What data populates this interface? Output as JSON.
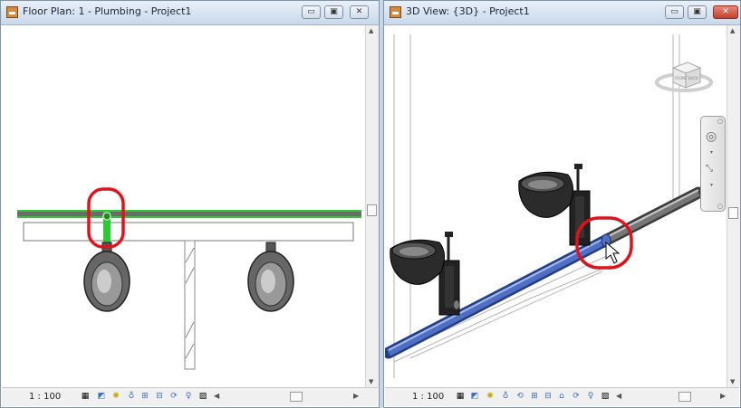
{
  "left_window": {
    "title": "Floor Plan: 1 - Plumbing - Project1",
    "scale": "1 : 100",
    "buttons": {
      "minimize": "▭",
      "maximize": "▣",
      "close": "✕"
    },
    "view_icons": [
      "detail-level-icon",
      "visual-style-icon",
      "sun-path-icon",
      "shadows-icon",
      "crop-view-icon",
      "show-crop-icon",
      "temporary-hide-icon",
      "reveal-hidden-icon",
      "design-options-icon"
    ]
  },
  "right_window": {
    "title": "3D View: {3D} - Project1",
    "scale": "1 : 100",
    "buttons": {
      "minimize": "▭",
      "maximize": "▣",
      "close": "✕"
    },
    "view_icons": [
      "detail-level-icon",
      "visual-style-icon",
      "sun-path-icon",
      "shadows-icon",
      "render-icon",
      "crop-view-icon",
      "show-crop-icon",
      "lock-view-icon",
      "temporary-hide-icon",
      "reveal-hidden-icon",
      "design-options-icon"
    ]
  },
  "viewcube_labels": {
    "front": "FRONT",
    "right": "BACK"
  },
  "colors": {
    "highlight": "#e0121b",
    "pipe_blue": "#3d57a8",
    "selected_green": "#2ec832",
    "titlebar": "#dbe6f3"
  }
}
